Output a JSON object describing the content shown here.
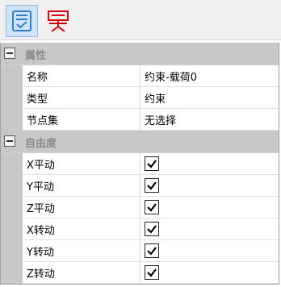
{
  "toolbar": {
    "buttons": [
      {
        "icon": "property-list-icon",
        "active": true
      },
      {
        "icon": "constraint-node-icon",
        "active": false
      }
    ]
  },
  "colors": {
    "accent": "#2f7fd0",
    "constraint_icon": "#d8000f",
    "category_bg": "#c8c8c8"
  },
  "properties": {
    "label": "属性",
    "rows": [
      {
        "name": "名称",
        "value": "约束-载荷0"
      },
      {
        "name": "类型",
        "value": "约束"
      },
      {
        "name": "节点集",
        "value": "无选择"
      }
    ]
  },
  "dof": {
    "label": "自由度",
    "rows": [
      {
        "name": "X平动",
        "checked": true
      },
      {
        "name": "Y平动",
        "checked": true
      },
      {
        "name": "Z平动",
        "checked": true
      },
      {
        "name": "X转动",
        "checked": true
      },
      {
        "name": "Y转动",
        "checked": true
      },
      {
        "name": "Z转动",
        "checked": true
      }
    ]
  }
}
